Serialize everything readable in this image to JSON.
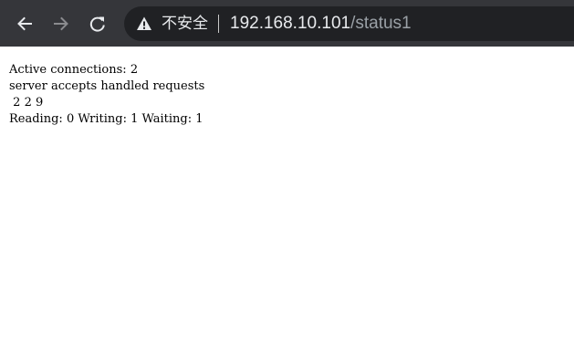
{
  "browser": {
    "security_label": "不安全",
    "url_host": "192.168.10.101",
    "url_path": "/status1",
    "icons": {
      "back": "back-arrow-icon",
      "forward": "forward-arrow-icon",
      "reload": "reload-icon",
      "warning": "warning-icon"
    },
    "colors": {
      "toolbar": "#35363a",
      "omnibox": "#202124",
      "url_host": "#e8eaed",
      "url_path": "#9aa0a6"
    }
  },
  "status": {
    "active_connections_label": "Active connections:",
    "active_connections": "2",
    "columns_header": "server accepts handled requests",
    "server_accepts": "2",
    "server_handled": "2",
    "server_requests": "9",
    "reading_label": "Reading:",
    "reading": "0",
    "writing_label": "Writing:",
    "writing": "1",
    "waiting_label": "Waiting:",
    "waiting": "1"
  }
}
